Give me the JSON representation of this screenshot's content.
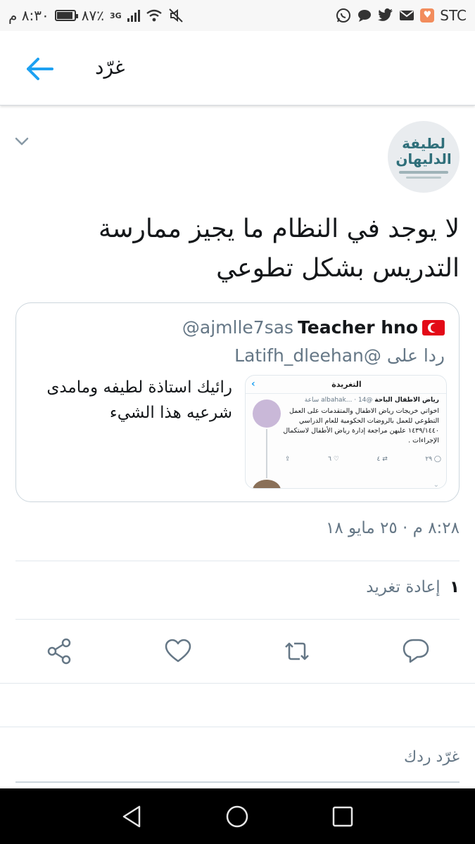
{
  "status_bar": {
    "time": "٨:٣٠ م",
    "battery_percent": "٨٧٪",
    "battery_level": 0.87,
    "network": "3G",
    "carrier": "STC"
  },
  "header": {
    "title": "غرّد"
  },
  "tweet": {
    "avatar_text": "لطيفة الدليهان",
    "text": "لا يوجد في النظام ما يجيز ممارسة التدريس بشكل تطوعي",
    "quote": {
      "display_name": "Teacher hno",
      "handle": "@ajmlle7sas",
      "reply_to_prefix": "ردا على",
      "reply_to_handle": "@Latifh_dleehan",
      "text": "رائيك استاذة لطيفه ومامدى شرعيه هذا الشيء",
      "media": {
        "screen_title": "التغريدة",
        "author": "رياض الاطفال الباحة",
        "handle_time": "@albahak... · 14 ساعة",
        "text": "اخواتي خريجات رياض الاطفال والمتقدمات على العمل التطوعي للعمل بالروضات الحكومية للعام الدراسي ١٤٣٩/١٤٤٠ عليهن مراجعة إدارة رياض الأطفال لاستكمال الإجراءات .",
        "replies": "٢٩",
        "retweets": "٤",
        "likes": "٦"
      }
    },
    "timestamp": "٨:٢٨ م · ٢٥ مايو ١٨",
    "retweet_count": "١",
    "retweet_label": "إعادة تغريد"
  },
  "reply": {
    "placeholder": "غرّد ردك"
  },
  "colors": {
    "accent": "#1da1f2",
    "icon_gray": "#657786",
    "border": "#e1e8ed"
  }
}
